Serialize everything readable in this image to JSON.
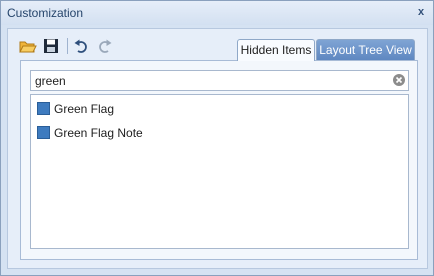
{
  "window": {
    "title": "Customization",
    "close_glyph": "x"
  },
  "toolbar": {
    "buttons": [
      {
        "name": "open-folder-icon"
      },
      {
        "name": "save-disk-icon"
      },
      {
        "name": "undo-icon"
      },
      {
        "name": "redo-icon"
      }
    ]
  },
  "tabs": [
    {
      "label": "Hidden Items",
      "selected": true
    },
    {
      "label": "Layout Tree View",
      "selected": false
    }
  ],
  "search": {
    "value": "green"
  },
  "items": [
    {
      "label": "Green Flag"
    },
    {
      "label": "Green Flag Note"
    }
  ],
  "colors": {
    "accent": "#5d86c0",
    "item_icon": "#3e7bbf",
    "title_text": "#25446b"
  }
}
